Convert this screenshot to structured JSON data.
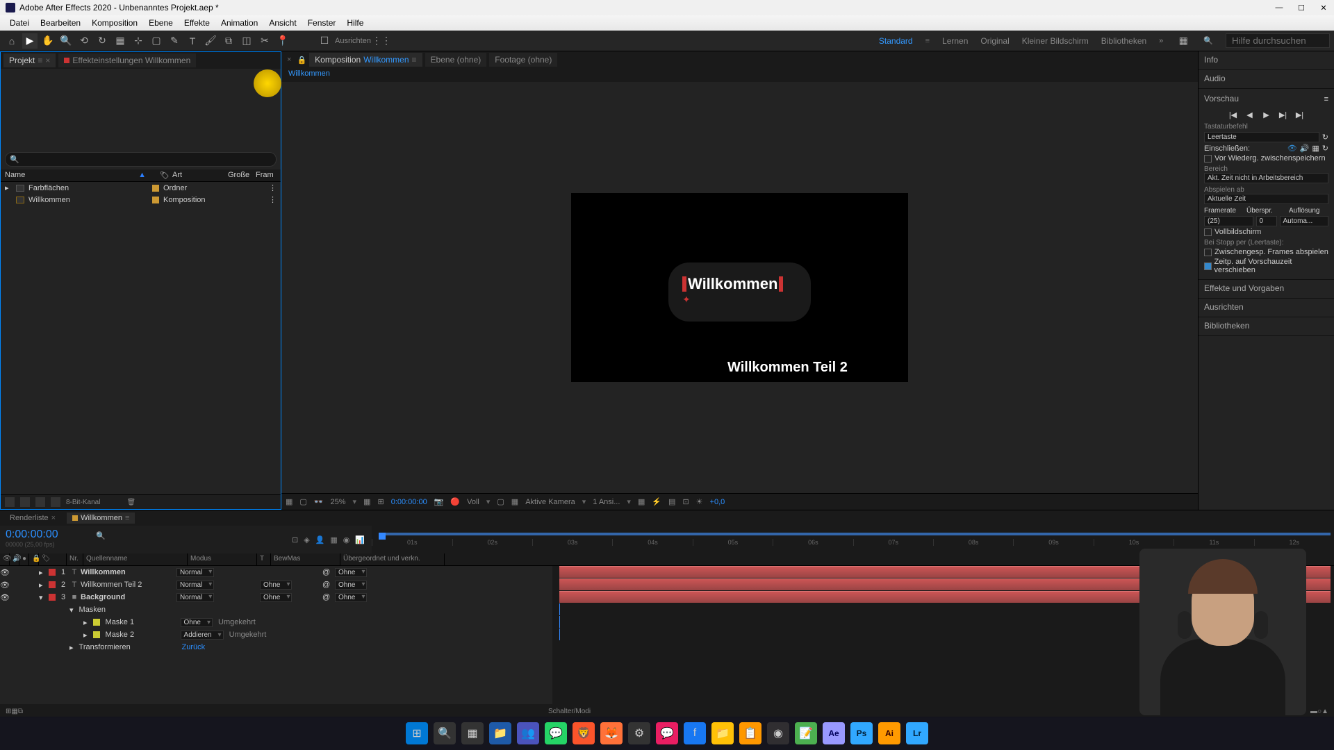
{
  "titlebar": {
    "title": "Adobe After Effects 2020 - Unbenanntes Projekt.aep *"
  },
  "menu": {
    "items": [
      "Datei",
      "Bearbeiten",
      "Komposition",
      "Ebene",
      "Effekte",
      "Animation",
      "Ansicht",
      "Fenster",
      "Hilfe"
    ]
  },
  "toolbar": {
    "ausrichten": "Ausrichten",
    "workspaces": [
      "Standard",
      "Lernen",
      "Original",
      "Kleiner Bildschirm",
      "Bibliotheken"
    ],
    "search_placeholder": "Hilfe durchsuchen"
  },
  "project_panel": {
    "tab_projekt": "Projekt",
    "tab_effect": "Effekteinstellungen Willkommen",
    "col_name": "Name",
    "col_art": "Art",
    "col_groesse": "Große",
    "col_fram": "Fram",
    "items": [
      {
        "name": "Farbflächen",
        "art": "Ordner"
      },
      {
        "name": "Willkommen",
        "art": "Komposition"
      }
    ],
    "footer_bit": "8-Bit-Kanal"
  },
  "comp_panel": {
    "tab_komposition": "Komposition",
    "tab_komposition_name": "Willkommen",
    "tab_ebene": "Ebene (ohne)",
    "tab_footage": "Footage (ohne)",
    "breadcrumb": "Willkommen",
    "text1": "Willkommen",
    "text2": "Willkommen Teil 2",
    "controls": {
      "zoom": "25%",
      "timecode": "0:00:00:00",
      "resolution": "Voll",
      "camera": "Aktive Kamera",
      "views": "1 Ansi...",
      "exposure": "+0,0"
    }
  },
  "right_panel": {
    "info": "Info",
    "audio": "Audio",
    "vorschau": "Vorschau",
    "tastatur": "Tastaturbefehl",
    "leertaste": "Leertaste",
    "einschliessen": "Einschließen:",
    "vor_wiederg": "Vor Wiederg. zwischenspeichern",
    "bereich": "Bereich",
    "bereich_val": "Akt. Zeit nicht in Arbeitsbereich",
    "abspielen": "Abspielen ab",
    "abspielen_val": "Aktuelle Zeit",
    "framerate": "Framerate",
    "ueberspr": "Überspr.",
    "aufloesung": "Auflösung",
    "framerate_val": "(25)",
    "ueberspr_val": "0",
    "aufloesung_val": "Automa...",
    "vollbild": "Vollbildschirm",
    "bei_stopp": "Bei Stopp per (Leertaste):",
    "zwischengesp": "Zwischengesp. Frames abspielen",
    "zeitp": "Zeitp. auf Vorschauzeit verschieben",
    "effekte": "Effekte und Vorgaben",
    "ausrichten": "Ausrichten",
    "bibliotheken": "Bibliotheken"
  },
  "timeline": {
    "tab_render": "Renderliste",
    "tab_comp": "Willkommen",
    "timecode": "0:00:00:00",
    "fps_text": "00000 (25,00 fps)",
    "ticks": [
      "01s",
      "02s",
      "03s",
      "04s",
      "05s",
      "06s",
      "07s",
      "08s",
      "09s",
      "10s",
      "11s",
      "12s"
    ],
    "col_nr": "Nr.",
    "col_quellenname": "Quellenname",
    "col_modus": "Modus",
    "col_t": "T",
    "col_bewmas": "BewMas",
    "col_ueber": "Übergeordnet und verkn.",
    "layers": [
      {
        "nr": "1",
        "name": "Willkommen",
        "mode": "Normal",
        "bew": "",
        "parent": "Ohne",
        "color": "#cc3333",
        "type": "T",
        "bold": true
      },
      {
        "nr": "2",
        "name": "Willkommen Teil 2",
        "mode": "Normal",
        "bew": "Ohne",
        "parent": "Ohne",
        "color": "#cc3333",
        "type": "T",
        "bold": false
      },
      {
        "nr": "3",
        "name": "Background",
        "mode": "Normal",
        "bew": "Ohne",
        "parent": "Ohne",
        "color": "#cc3333",
        "type": "■",
        "bold": true
      }
    ],
    "masken": "Masken",
    "maske1": "Maske 1",
    "maske2": "Maske 2",
    "mask_mode_ohne": "Ohne",
    "mask_mode_add": "Addieren",
    "umgekehrt": "Umgekehrt",
    "transformieren": "Transformieren",
    "zurueck": "Zurück",
    "schalter": "Schalter/Modi"
  }
}
